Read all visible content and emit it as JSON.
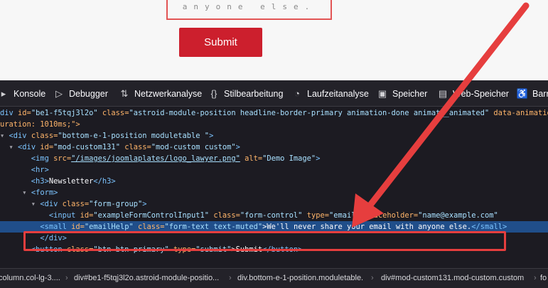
{
  "preview": {
    "help_text": "anyone else.",
    "submit_label": "Submit",
    "colors": {
      "submit_bg": "#cc1f2d",
      "annotation": "#e63e3e"
    }
  },
  "devtools": {
    "tabs": [
      {
        "icon": "console-icon",
        "label": "Konsole"
      },
      {
        "icon": "debugger-icon",
        "label": "Debugger"
      },
      {
        "icon": "network-icon",
        "label": "Netzwerkanalyse"
      },
      {
        "icon": "style-editor-icon",
        "label": "Stilbearbeitung"
      },
      {
        "icon": "performance-icon",
        "label": "Laufzeitanalyse"
      },
      {
        "icon": "memory-icon",
        "label": "Speicher"
      },
      {
        "icon": "storage-icon",
        "label": "Web-Speicher"
      },
      {
        "icon": "accessibility-icon",
        "label": "Barr"
      }
    ],
    "markup": [
      {
        "pre": "div ",
        "a1": "id=",
        "v1": "\"be1-f5tqj3l2o\"",
        "a2": " class=",
        "v2": "\"astroid-module-position headline-border-primary animation-done animat__animated\"",
        "a3": " data-animation=",
        "v3": ""
      },
      {
        "text": "uration: 1010ms;\">"
      },
      {
        "tog": "▾",
        "open": "<div ",
        "a1": "class=",
        "v1": "\"bottom-e-1-position moduletable \"",
        "close": ">"
      },
      {
        "tog": "▾",
        "open": "<div ",
        "a1": "id=",
        "v1": "\"mod-custom131\"",
        "a2": " class=",
        "v2": "\"mod-custom custom\"",
        "close": ">"
      },
      {
        "open": "<img ",
        "a1": "src=",
        "link": "\"/images/joomlaplates/logo_lawyer.png\"",
        "a2": " alt=",
        "v2": "\"Demo Image\"",
        "close": ">"
      },
      {
        "open": "<hr>"
      },
      {
        "open": "<h3>",
        "text": "Newsletter",
        "close": "</h3>"
      },
      {
        "tog": "▾",
        "open": "<form>"
      },
      {
        "tog": "▾",
        "open": "<div ",
        "a1": "class=",
        "v1": "\"form-group\"",
        "close": ">"
      },
      {
        "open": "<input ",
        "a1": "id=",
        "v1": "\"exampleFormControlInput1\"",
        "a2": " class=",
        "v2": "\"form-control\"",
        "a3": " type=",
        "v3": "\"email\"",
        "a4": " placeholder=",
        "v4": "\"name@example.com\""
      },
      {
        "open": "<small ",
        "a1": "id=",
        "v1": "\"emailHelp\"",
        "a2": " class=",
        "v2": "\"form-text text-muted\"",
        "text": ">We'll never share your email with anyone else.",
        "close": "</small>"
      },
      {
        "open": "</div>"
      },
      {
        "open": "<button ",
        "a1": "class=",
        "v1": "\"btn btn-primary\"",
        "a2": " type=",
        "v2": "\"submit\"",
        "text": ">Submit",
        "close": "</button>"
      }
    ],
    "breadcrumbs": [
      "column.col-lg-3....",
      "div#be1-f5tqj3l2o.astroid-module-positio...",
      "div.bottom-e-1-position.moduletable.",
      "div#mod-custom131.mod-custom.custom",
      "fo"
    ]
  }
}
